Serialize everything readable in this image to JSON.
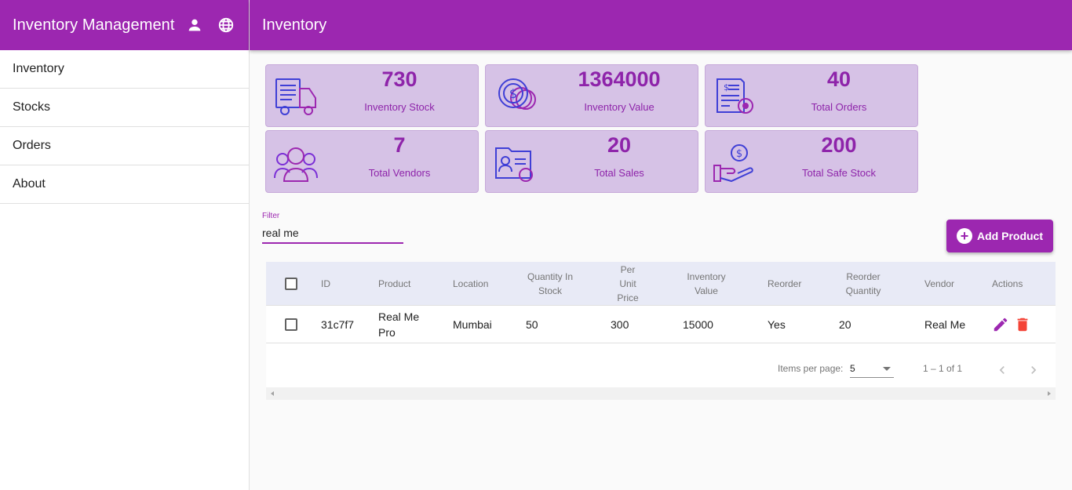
{
  "sidebar": {
    "title": "Inventory Management",
    "icons": [
      "person-icon",
      "globe-icon"
    ],
    "items": [
      {
        "label": "Inventory"
      },
      {
        "label": "Stocks"
      },
      {
        "label": "Orders"
      },
      {
        "label": "About"
      }
    ]
  },
  "topbar": {
    "title": "Inventory"
  },
  "cards": [
    {
      "value": "730",
      "label": "Inventory Stock",
      "icon": "delivery-truck-icon"
    },
    {
      "value": "1364000",
      "label": "Inventory Value",
      "icon": "coins-icon"
    },
    {
      "value": "40",
      "label": "Total Orders",
      "icon": "invoice-icon"
    },
    {
      "value": "7",
      "label": "Total Vendors",
      "icon": "people-group-icon"
    },
    {
      "value": "20",
      "label": "Total Sales",
      "icon": "folder-profile-icon"
    },
    {
      "value": "200",
      "label": "Total Safe Stock",
      "icon": "hand-money-icon"
    }
  ],
  "filter": {
    "label": "Filter",
    "value": "real me"
  },
  "add_button": {
    "label": "Add Product"
  },
  "table": {
    "headers": {
      "id": "ID",
      "product": "Product",
      "location": "Location",
      "qty_line1": "Quantity In",
      "qty_line2": "Stock",
      "price_line1": "Per",
      "price_line2": "Unit",
      "price_line3": "Price",
      "inv_line1": "Inventory",
      "inv_line2": "Value",
      "reorder": "Reorder",
      "rq_line1": "Reorder",
      "rq_line2": "Quantity",
      "vendor": "Vendor",
      "actions": "Actions"
    },
    "rows": [
      {
        "id": "31c7f7",
        "product_line1": "Real Me",
        "product_line2": "Pro",
        "location": "Mumbai",
        "quantity": "50",
        "unit_price": "300",
        "inventory_value": "15000",
        "reorder": "Yes",
        "reorder_quantity": "20",
        "vendor": "Real Me"
      }
    ]
  },
  "paginator": {
    "items_per_page_label": "Items per page:",
    "page_size": "5",
    "range": "1 – 1 of 1"
  },
  "colors": {
    "primary": "#9c27b0",
    "card_bg": "#d6c2e6",
    "card_text": "#8e24aa",
    "delete": "#f44336"
  }
}
